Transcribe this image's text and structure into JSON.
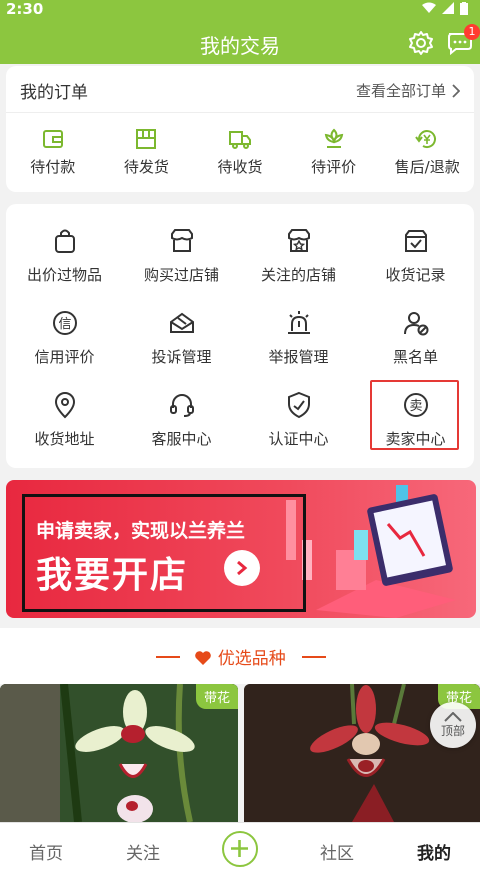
{
  "status_bar": {
    "time": "2:30"
  },
  "header": {
    "title": "我的交易",
    "message_badge": "1"
  },
  "orders": {
    "title": "我的订单",
    "view_all": "查看全部订单",
    "items": [
      {
        "label": "待付款",
        "icon": "wallet-icon"
      },
      {
        "label": "待发货",
        "icon": "package-icon"
      },
      {
        "label": "待收货",
        "icon": "truck-icon"
      },
      {
        "label": "待评价",
        "icon": "flower-icon"
      },
      {
        "label": "售后/退款",
        "icon": "refund-icon"
      }
    ]
  },
  "services": {
    "items": [
      {
        "label": "出价过物品",
        "icon": "bag-icon"
      },
      {
        "label": "购买过店铺",
        "icon": "shop-icon"
      },
      {
        "label": "关注的店铺",
        "icon": "star-shop-icon"
      },
      {
        "label": "收货记录",
        "icon": "box-check-icon"
      },
      {
        "label": "信用评价",
        "icon": "credit-icon"
      },
      {
        "label": "投诉管理",
        "icon": "complaint-icon"
      },
      {
        "label": "举报管理",
        "icon": "alarm-icon"
      },
      {
        "label": "黑名单",
        "icon": "user-block-icon"
      },
      {
        "label": "收货地址",
        "icon": "location-icon"
      },
      {
        "label": "客服中心",
        "icon": "headset-icon"
      },
      {
        "label": "认证中心",
        "icon": "shield-icon"
      },
      {
        "label": "卖家中心",
        "icon": "seller-icon"
      }
    ]
  },
  "banner": {
    "subtitle": "申请卖家，实现以兰养兰",
    "main": "我要开店"
  },
  "section": {
    "title": "优选品种"
  },
  "products": [
    {
      "tag": "带花"
    },
    {
      "tag": "带花"
    }
  ],
  "back_to_top": "顶部",
  "tabbar": {
    "tabs": [
      "首页",
      "关注",
      "社区",
      "我的"
    ]
  },
  "colors": {
    "brand_green": "#8cc63f",
    "accent_orange": "#e64a19",
    "banner_red": "#e8283f"
  }
}
